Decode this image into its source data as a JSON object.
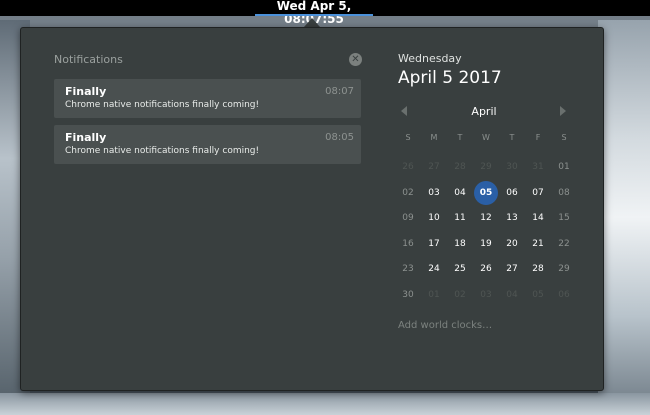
{
  "topbar": {
    "clock": "Wed Apr  5, 08:07:55"
  },
  "notifications": {
    "header": "Notifications",
    "clear_icon": "close-icon",
    "items": [
      {
        "title": "Finally",
        "body": "Chrome native notifications finally coming!",
        "time": "08:07"
      },
      {
        "title": "Finally",
        "body": "Chrome native notifications finally coming!",
        "time": "08:05"
      }
    ]
  },
  "calendar": {
    "day_name": "Wednesday",
    "full_date": "April  5 2017",
    "month": "April",
    "prev_icon": "chevron-left-icon",
    "next_icon": "chevron-right-icon",
    "weekdays": [
      "S",
      "M",
      "T",
      "W",
      "T",
      "F",
      "S"
    ],
    "weeks": [
      [
        "26",
        "27",
        "28",
        "29",
        "30",
        "31",
        "01"
      ],
      [
        "02",
        "03",
        "04",
        "05",
        "06",
        "07",
        "08"
      ],
      [
        "09",
        "10",
        "11",
        "12",
        "13",
        "14",
        "15"
      ],
      [
        "16",
        "17",
        "18",
        "19",
        "20",
        "21",
        "22"
      ],
      [
        "23",
        "24",
        "25",
        "26",
        "27",
        "28",
        "29"
      ],
      [
        "30",
        "01",
        "02",
        "03",
        "04",
        "05",
        "06"
      ]
    ],
    "today": "05",
    "world_clocks_link": "Add world clocks…"
  },
  "colors": {
    "panel_bg": "#393f3f",
    "card_bg": "#4a5050",
    "accent": "#2a5fa6"
  }
}
